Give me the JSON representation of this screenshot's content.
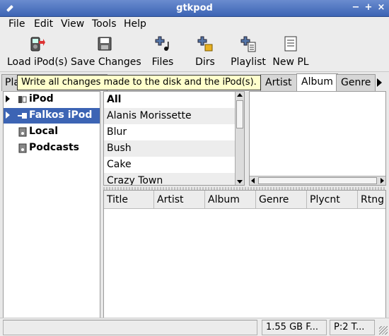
{
  "window": {
    "title": "gtkpod"
  },
  "menu": [
    "File",
    "Edit",
    "View",
    "Tools",
    "Help"
  ],
  "toolbar": [
    {
      "label": "Load iPod(s)",
      "icon": "load-ipod-icon"
    },
    {
      "label": "Save Changes",
      "icon": "save-icon"
    },
    {
      "label": "Files",
      "icon": "add-files-icon"
    },
    {
      "label": "Dirs",
      "icon": "add-dirs-icon"
    },
    {
      "label": "Playlist",
      "icon": "add-playlist-icon"
    },
    {
      "label": "New PL",
      "icon": "new-playlist-icon"
    }
  ],
  "tabs": {
    "left_tab": "Pla",
    "items": [
      "Artist",
      "Album",
      "Genre"
    ],
    "active": "Album"
  },
  "tooltip": "Write all changes made to the disk and the iPod(s).",
  "playlists": [
    {
      "label": "iPod",
      "expander": true,
      "icon": "ipod-icon",
      "selected": false
    },
    {
      "label": "Falkos iPod",
      "expander": true,
      "icon": "ipod-connected-icon",
      "selected": true
    },
    {
      "label": "Local",
      "expander": false,
      "icon": "local-icon",
      "selected": false
    },
    {
      "label": "Podcasts",
      "expander": false,
      "icon": "podcast-icon",
      "selected": false
    }
  ],
  "artists": [
    "All",
    "Alanis Morissette",
    "Blur",
    "Bush",
    "Cake",
    "Crazy Town"
  ],
  "track_columns": [
    "Title",
    "Artist",
    "Album",
    "Genre",
    "Plycnt",
    "Rtng"
  ],
  "status": {
    "space": "1.55 GB F...",
    "playlist": "P:2 T..."
  },
  "colors": {
    "selection": "#3c64b4",
    "titlebar": "#4a72c0",
    "tooltip": "#ffffcc"
  }
}
